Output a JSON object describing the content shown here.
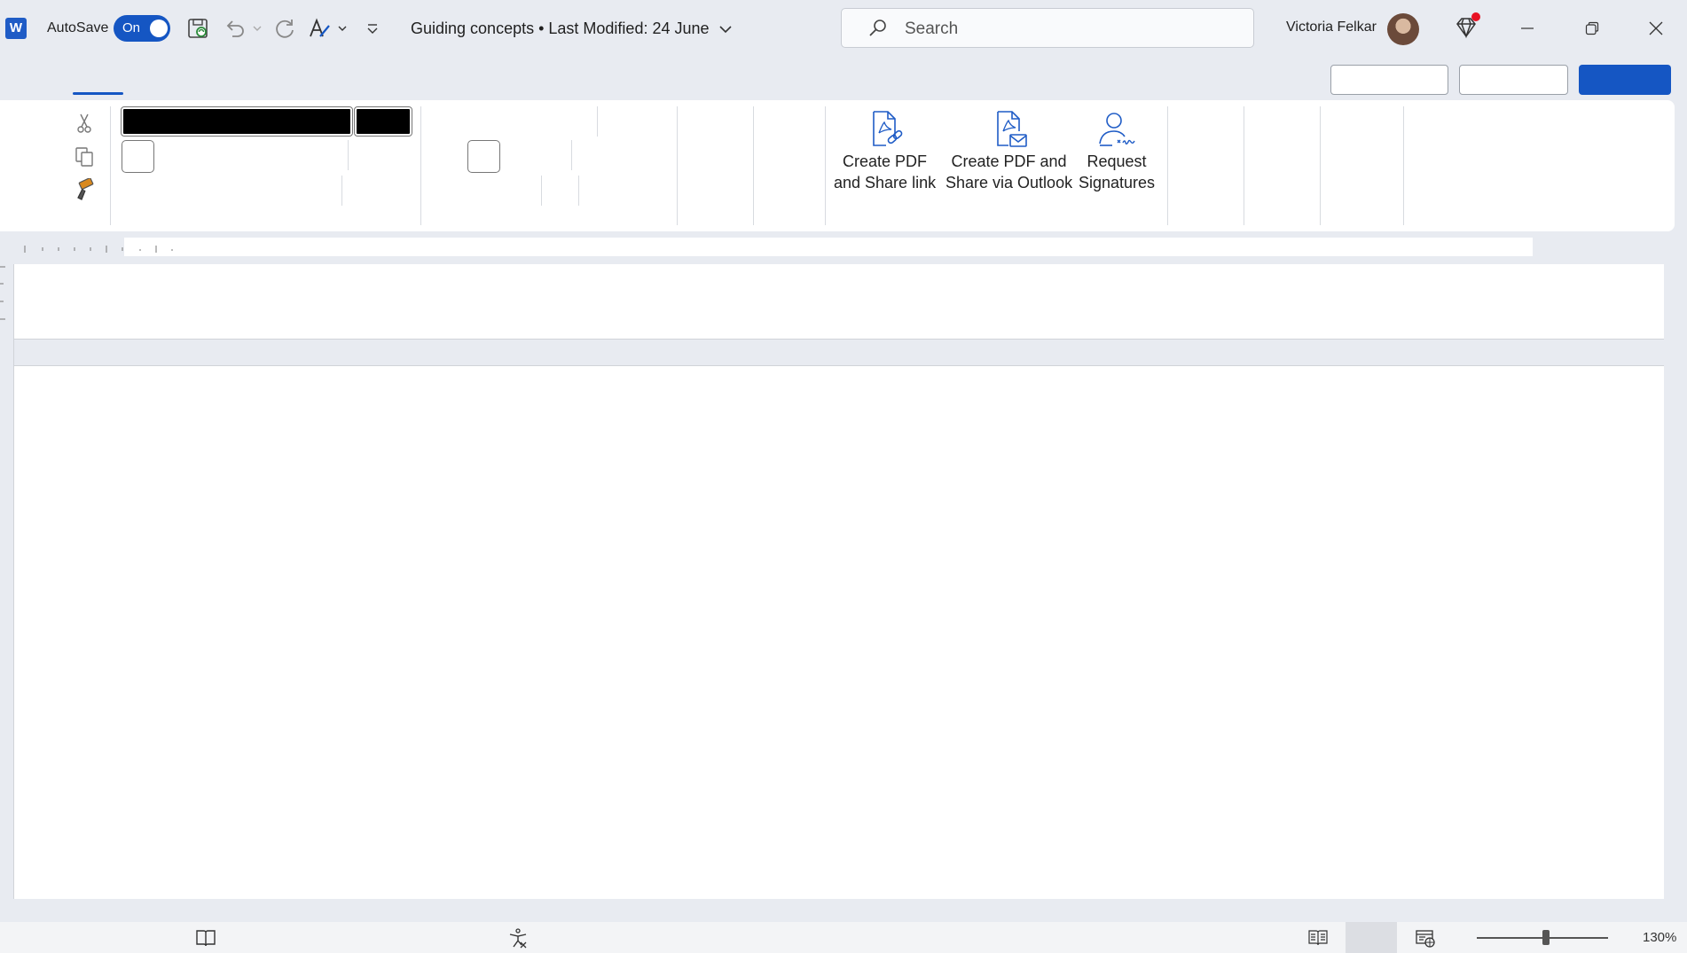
{
  "titlebar": {
    "app_logo": "W",
    "autosave_label": "AutoSave",
    "autosave_state": "On",
    "doc_title": "Guiding concepts • Last Modified: 24 June",
    "search_placeholder": "Search",
    "user_name": "Victoria Felkar",
    "icons": [
      "word-icon",
      "save-icon",
      "undo-icon",
      "redo-icon",
      "editor-icon",
      "customize-icon",
      "premium-diamond-icon",
      "minimize-icon",
      "restore-icon",
      "close-icon"
    ]
  },
  "ribbon": {
    "clipboard_icons": [
      "cut-icon",
      "copy-icon",
      "format-painter-icon"
    ],
    "create_pdf_share_link": "Create PDF\nand Share link",
    "create_pdf_outlook": "Create PDF and\nShare via Outlook",
    "request_signatures": "Request\nSignatures"
  },
  "statusbar": {
    "zoom": "130%",
    "icons": [
      "focus-icon",
      "accessibility-icon",
      "read-mode-icon",
      "print-layout-icon",
      "web-layout-icon"
    ]
  },
  "colors": {
    "accent": "#1556c3",
    "background": "#e8ebf1",
    "notification": "#e81123"
  }
}
